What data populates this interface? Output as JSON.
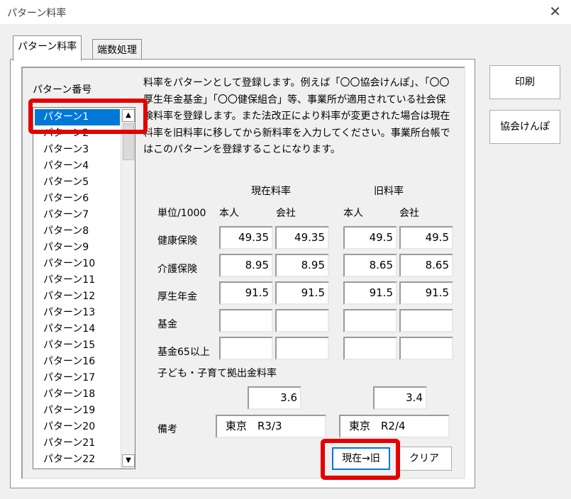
{
  "window": {
    "title": "パターン料率",
    "close": "✕"
  },
  "tabs": [
    {
      "label": "パターン料率",
      "active": true
    },
    {
      "label": "端数処理",
      "active": false
    }
  ],
  "pattern_list": {
    "label": "パターン番号",
    "items": [
      "パターン1",
      "パターン2",
      "パターン3",
      "パターン4",
      "パターン5",
      "パターン6",
      "パターン7",
      "パターン8",
      "パターン9",
      "パターン10",
      "パターン11",
      "パターン12",
      "パターン13",
      "パターン14",
      "パターン15",
      "パターン16",
      "パターン17",
      "パターン18",
      "パターン19",
      "パターン20",
      "パターン21",
      "パターン22"
    ],
    "selected": "パターン1"
  },
  "description": "料率をパターンとして登録します。例えば「〇〇協会けんぽ」、「〇〇厚生年金基金」「〇〇健保組合」等、事業所が適用されている社会保険料率を登録します。また法改正により料率が変更された場合は現在料率を旧料率に移してから新料率を入力してください。事業所台帳ではこのパターンを登録することになります。",
  "rates": {
    "current_header": "現在料率",
    "old_header": "旧料率",
    "unit_label": "単位/1000",
    "col_person": "本人",
    "col_company": "会社",
    "rows": [
      {
        "label": "健康保険",
        "cur_person": "49.35",
        "cur_company": "49.35",
        "old_person": "49.5",
        "old_company": "49.5"
      },
      {
        "label": "介護保険",
        "cur_person": "8.95",
        "cur_company": "8.95",
        "old_person": "8.65",
        "old_company": "8.65"
      },
      {
        "label": "厚生年金",
        "cur_person": "91.5",
        "cur_company": "91.5",
        "old_person": "91.5",
        "old_company": "91.5"
      },
      {
        "label": "基金",
        "cur_person": "",
        "cur_company": "",
        "old_person": "",
        "old_company": ""
      },
      {
        "label": "基金65以上",
        "cur_person": "",
        "cur_company": "",
        "old_person": "",
        "old_company": ""
      }
    ],
    "child_label": "子ども・子育て拠出金料率",
    "child_current": "3.6",
    "child_old": "3.4",
    "remarks_label": "備考",
    "remarks_current": "東京　R3/3",
    "remarks_old": "東京　R2/4"
  },
  "buttons": {
    "print": "印刷",
    "kyokai": "協会けんぽ",
    "move": "現在→旧",
    "clear": "クリア"
  },
  "colors": {
    "highlight": "#e30000",
    "selection": "#0078d7"
  }
}
